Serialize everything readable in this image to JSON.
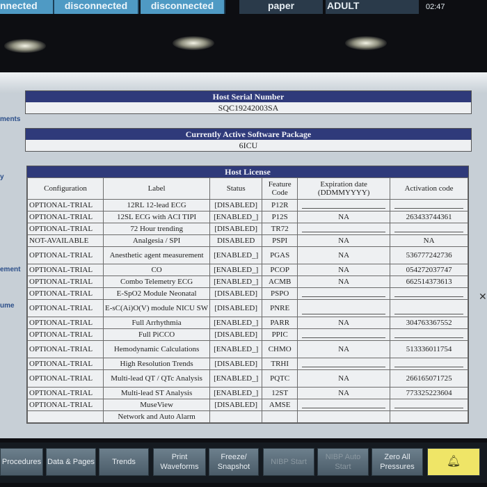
{
  "top_bar": {
    "tabs": [
      "nnected",
      "disconnected",
      "disconnected"
    ],
    "paper": "paper",
    "patient_category": "ADULT",
    "time": "02:47"
  },
  "left_labels": [
    "ments",
    "y",
    "ement",
    "ume"
  ],
  "serial": {
    "title": "Host Serial Number",
    "value": "SQC19242003SA"
  },
  "software": {
    "title": "Currently Active Software Package",
    "value": "6ICU"
  },
  "license": {
    "title": "Host License",
    "headers": [
      "Configuration",
      "Label",
      "Status",
      "Feature Code",
      "Expiration date (DDMMYYYY)",
      "Activation code"
    ],
    "rows": [
      [
        "OPTIONAL-TRIAL",
        "12RL 12-lead ECG",
        "[DISABLED]",
        "P12R",
        "",
        ""
      ],
      [
        "OPTIONAL-TRIAL",
        "12SL ECG with ACI TIPI",
        "[ENABLED_]",
        "P12S",
        "NA",
        "263433744361"
      ],
      [
        "OPTIONAL-TRIAL",
        "72 Hour trending",
        "[DISABLED]",
        "TR72",
        "",
        ""
      ],
      [
        "NOT-AVAILABLE",
        "Analgesia / SPI",
        "DISABLED",
        "PSPI",
        "NA",
        "NA"
      ],
      [
        "OPTIONAL-TRIAL",
        "Anesthetic agent measurement",
        "[ENABLED_]",
        "PGAS",
        "NA",
        "536777242736"
      ],
      [
        "OPTIONAL-TRIAL",
        "CO",
        "[ENABLED_]",
        "PCOP",
        "NA",
        "054272037747"
      ],
      [
        "OPTIONAL-TRIAL",
        "Combo Telemetry ECG",
        "[ENABLED_]",
        "ACMB",
        "NA",
        "662514373613"
      ],
      [
        "OPTIONAL-TRIAL",
        "E-SpO2 Module Neonatal",
        "[DISABLED]",
        "PSPO",
        "",
        ""
      ],
      [
        "OPTIONAL-TRIAL",
        "E-sC(Ai)O(V) module NICU SW",
        "[DISABLED]",
        "PNRE",
        "",
        ""
      ],
      [
        "OPTIONAL-TRIAL",
        "Full Arrhythmia",
        "[ENABLED_]",
        "PARR",
        "NA",
        "304763367552"
      ],
      [
        "OPTIONAL-TRIAL",
        "Full PiCCO",
        "[DISABLED]",
        "PPIC",
        "",
        ""
      ],
      [
        "OPTIONAL-TRIAL",
        "Hemodynamic Calculations",
        "[ENABLED_]",
        "CHMO",
        "NA",
        "513336011754"
      ],
      [
        "OPTIONAL-TRIAL",
        "High Resolution Trends",
        "[DISABLED]",
        "TRHI",
        "",
        ""
      ],
      [
        "OPTIONAL-TRIAL",
        "Multi-lead QT / QTc Analysis",
        "[ENABLED_]",
        "PQTC",
        "NA",
        "266165071725"
      ],
      [
        "OPTIONAL-TRIAL",
        "Multi-lead ST Analysis",
        "[ENABLED_]",
        "12ST",
        "NA",
        "773325223604"
      ],
      [
        "OPTIONAL-TRIAL",
        "MuseView",
        "[DISABLED]",
        "AMSE",
        "",
        ""
      ],
      [
        "",
        "Network and Auto Alarm",
        "",
        "",
        "",
        ""
      ]
    ]
  },
  "softkeys": [
    {
      "label": "Procedures",
      "dim": false
    },
    {
      "label": "Data & Pages",
      "dim": false
    },
    {
      "label": "Trends",
      "dim": false
    },
    {
      "label": "Print Waveforms",
      "dim": false
    },
    {
      "label": "Freeze/ Snapshot",
      "dim": false
    },
    {
      "label": "NIBP Start",
      "dim": true
    },
    {
      "label": "NIBP Auto Start",
      "dim": true
    },
    {
      "label": "Zero All Pressures",
      "dim": false
    }
  ],
  "alarm_icon": "alarm-bell-icon"
}
